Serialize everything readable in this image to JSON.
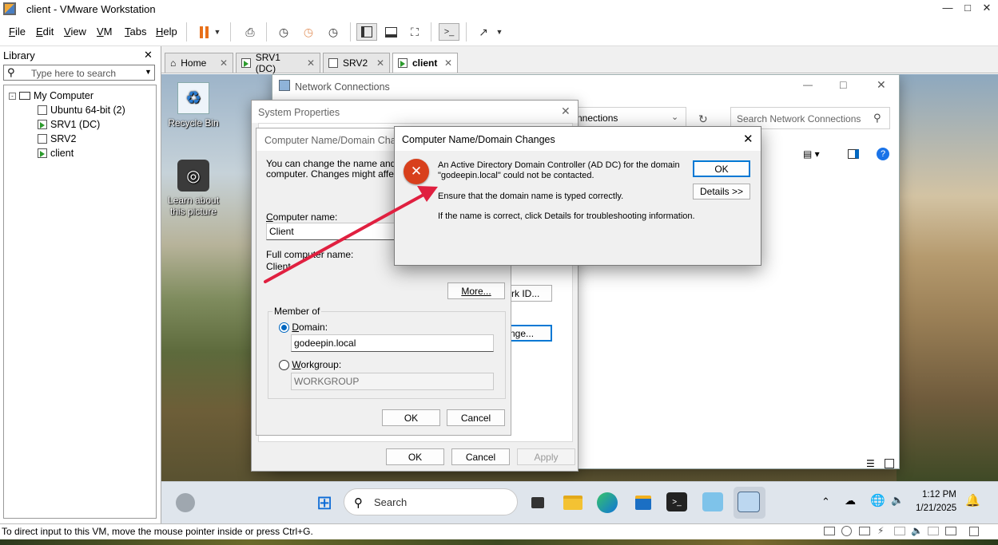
{
  "app": {
    "title": "client - VMware Workstation",
    "menu": [
      "File",
      "Edit",
      "View",
      "VM",
      "Tabs",
      "Help"
    ]
  },
  "library": {
    "title": "Library",
    "search_placeholder": "Type here to search",
    "root": "My Computer",
    "items": [
      "Ubuntu 64-bit (2)",
      "SRV1 (DC)",
      "SRV2",
      "client"
    ]
  },
  "tabs": [
    "Home",
    "SRV1 (DC)",
    "SRV2",
    "client"
  ],
  "desktop": {
    "icons": [
      "Recycle Bin",
      "Learn about this picture"
    ]
  },
  "network_connections": {
    "title": "Network Connections",
    "address_partial": "nnections",
    "search_placeholder": "Search Network Connections"
  },
  "system_properties": {
    "title": "System Properties",
    "ok": "OK",
    "cancel": "Cancel",
    "apply": "Apply",
    "network_id_partial": "rk ID...",
    "change_partial": "nge..."
  },
  "cn_dc": {
    "title_partial": "Computer Name/Domain Chang",
    "intro_line1": "You can change the name and the",
    "intro_line2": "computer. Changes might affect ac",
    "computer_name_label": "Computer name:",
    "computer_name_value": "Client",
    "full_name_label": "Full computer name:",
    "full_name_value": "Client",
    "more_button": "More...",
    "member_of": "Member of",
    "domain_label": "Domain:",
    "domain_value": "godeepin.local",
    "workgroup_label": "Workgroup:",
    "workgroup_value": "WORKGROUP",
    "ok": "OK",
    "cancel": "Cancel"
  },
  "error_dialog": {
    "title": "Computer Name/Domain Changes",
    "line1": "An Active Directory Domain Controller (AD DC) for the domain",
    "line2": "\"godeepin.local\" could not be contacted.",
    "line3": "Ensure that the domain name is typed correctly.",
    "line4": "If the name is correct, click Details for troubleshooting information.",
    "ok": "OK",
    "details": "Details >>"
  },
  "taskbar": {
    "search_placeholder": "Search",
    "time": "1:12 PM",
    "date": "1/21/2025"
  },
  "status": {
    "message": "To direct input to this VM, move the mouse pointer inside or press Ctrl+G."
  },
  "colors": {
    "error_red": "#d8401c",
    "accent": "#0078d4",
    "arrow": "#e02040"
  }
}
